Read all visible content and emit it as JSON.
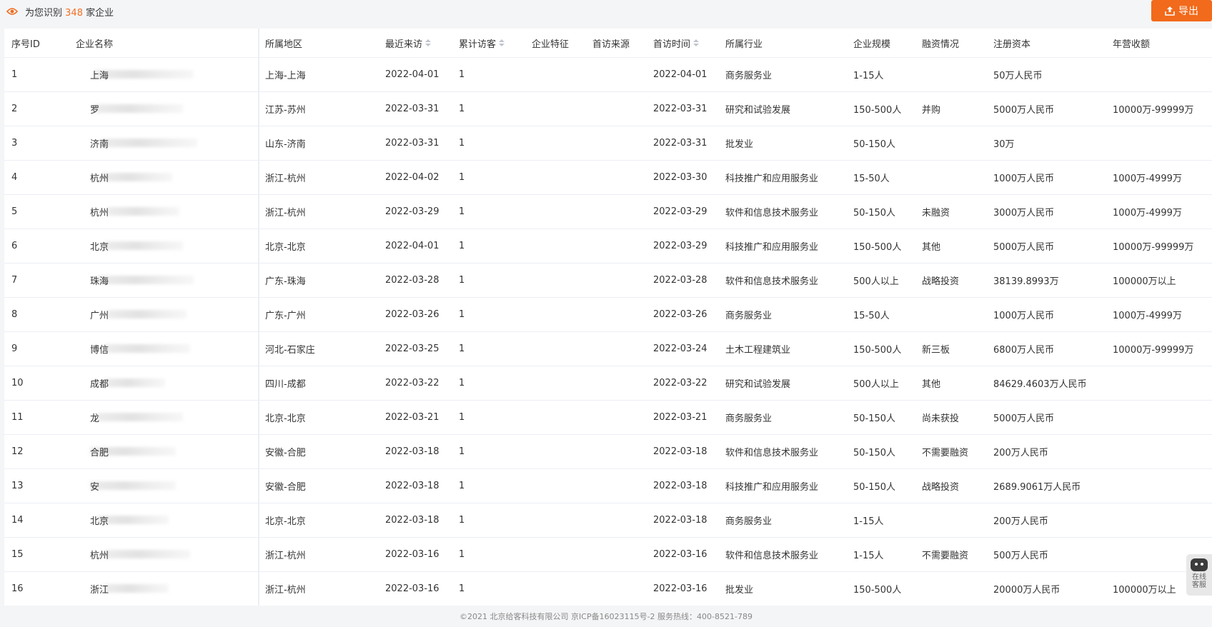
{
  "header": {
    "prefix": "为您识别",
    "count": "348",
    "suffix": "家企业",
    "export_label": "导出"
  },
  "table": {
    "columns": [
      "序号ID",
      "企业名称",
      "所属地区",
      "最近来访",
      "累计访客",
      "企业特征",
      "首访来源",
      "首访时间",
      "所属行业",
      "企业规模",
      "融资情况",
      "注册资本",
      "年营收额"
    ],
    "rows": [
      {
        "id": "1",
        "name": "上海",
        "region": "上海-上海",
        "last_visit": "2022-04-01",
        "visitors": "1",
        "feature": "",
        "source": "",
        "first_visit": "2022-04-01",
        "industry": "商务服务业",
        "size": "1-15人",
        "financing": "",
        "capital": "50万人民币",
        "revenue": ""
      },
      {
        "id": "2",
        "name": "罗",
        "region": "江苏-苏州",
        "last_visit": "2022-03-31",
        "visitors": "1",
        "feature": "",
        "source": "",
        "first_visit": "2022-03-31",
        "industry": "研究和试验发展",
        "size": "150-500人",
        "financing": "并购",
        "capital": "5000万人民币",
        "revenue": "10000万-99999万"
      },
      {
        "id": "3",
        "name": "济南",
        "region": "山东-济南",
        "last_visit": "2022-03-31",
        "visitors": "1",
        "feature": "",
        "source": "",
        "first_visit": "2022-03-31",
        "industry": "批发业",
        "size": "50-150人",
        "financing": "",
        "capital": "30万",
        "revenue": ""
      },
      {
        "id": "4",
        "name": "杭州",
        "region": "浙江-杭州",
        "last_visit": "2022-04-02",
        "visitors": "1",
        "feature": "",
        "source": "",
        "first_visit": "2022-03-30",
        "industry": "科技推广和应用服务业",
        "size": "15-50人",
        "financing": "",
        "capital": "1000万人民币",
        "revenue": "1000万-4999万"
      },
      {
        "id": "5",
        "name": "杭州",
        "region": "浙江-杭州",
        "last_visit": "2022-03-29",
        "visitors": "1",
        "feature": "",
        "source": "",
        "first_visit": "2022-03-29",
        "industry": "软件和信息技术服务业",
        "size": "50-150人",
        "financing": "未融资",
        "capital": "3000万人民币",
        "revenue": "1000万-4999万"
      },
      {
        "id": "6",
        "name": "北京",
        "region": "北京-北京",
        "last_visit": "2022-04-01",
        "visitors": "1",
        "feature": "",
        "source": "",
        "first_visit": "2022-03-29",
        "industry": "科技推广和应用服务业",
        "size": "150-500人",
        "financing": "其他",
        "capital": "5000万人民币",
        "revenue": "10000万-99999万"
      },
      {
        "id": "7",
        "name": "珠海",
        "region": "广东-珠海",
        "last_visit": "2022-03-28",
        "visitors": "1",
        "feature": "",
        "source": "",
        "first_visit": "2022-03-28",
        "industry": "软件和信息技术服务业",
        "size": "500人以上",
        "financing": "战略投资",
        "capital": "38139.8993万",
        "revenue": "100000万以上"
      },
      {
        "id": "8",
        "name": "广州",
        "region": "广东-广州",
        "last_visit": "2022-03-26",
        "visitors": "1",
        "feature": "",
        "source": "",
        "first_visit": "2022-03-26",
        "industry": "商务服务业",
        "size": "15-50人",
        "financing": "",
        "capital": "1000万人民币",
        "revenue": "1000万-4999万"
      },
      {
        "id": "9",
        "name": "博信",
        "region": "河北-石家庄",
        "last_visit": "2022-03-25",
        "visitors": "1",
        "feature": "",
        "source": "",
        "first_visit": "2022-03-24",
        "industry": "土木工程建筑业",
        "size": "150-500人",
        "financing": "新三板",
        "capital": "6800万人民币",
        "revenue": "10000万-99999万"
      },
      {
        "id": "10",
        "name": "成都",
        "region": "四川-成都",
        "last_visit": "2022-03-22",
        "visitors": "1",
        "feature": "",
        "source": "",
        "first_visit": "2022-03-22",
        "industry": "研究和试验发展",
        "size": "500人以上",
        "financing": "其他",
        "capital": "84629.4603万人民币",
        "revenue": ""
      },
      {
        "id": "11",
        "name": "龙",
        "region": "北京-北京",
        "last_visit": "2022-03-21",
        "visitors": "1",
        "feature": "",
        "source": "",
        "first_visit": "2022-03-21",
        "industry": "商务服务业",
        "size": "50-150人",
        "financing": "尚未获投",
        "capital": "5000万人民币",
        "revenue": ""
      },
      {
        "id": "12",
        "name": "合肥",
        "region": "安徽-合肥",
        "last_visit": "2022-03-18",
        "visitors": "1",
        "feature": "",
        "source": "",
        "first_visit": "2022-03-18",
        "industry": "软件和信息技术服务业",
        "size": "50-150人",
        "financing": "不需要融资",
        "capital": "200万人民币",
        "revenue": ""
      },
      {
        "id": "13",
        "name": "安",
        "region": "安徽-合肥",
        "last_visit": "2022-03-18",
        "visitors": "1",
        "feature": "",
        "source": "",
        "first_visit": "2022-03-18",
        "industry": "科技推广和应用服务业",
        "size": "50-150人",
        "financing": "战略投资",
        "capital": "2689.9061万人民币",
        "revenue": ""
      },
      {
        "id": "14",
        "name": "北京",
        "region": "北京-北京",
        "last_visit": "2022-03-18",
        "visitors": "1",
        "feature": "",
        "source": "",
        "first_visit": "2022-03-18",
        "industry": "商务服务业",
        "size": "1-15人",
        "financing": "",
        "capital": "200万人民币",
        "revenue": ""
      },
      {
        "id": "15",
        "name": "杭州",
        "region": "浙江-杭州",
        "last_visit": "2022-03-16",
        "visitors": "1",
        "feature": "",
        "source": "",
        "first_visit": "2022-03-16",
        "industry": "软件和信息技术服务业",
        "size": "1-15人",
        "financing": "不需要融资",
        "capital": "500万人民币",
        "revenue": ""
      },
      {
        "id": "16",
        "name": "浙江",
        "region": "浙江-杭州",
        "last_visit": "2022-03-16",
        "visitors": "1",
        "feature": "",
        "source": "",
        "first_visit": "2022-03-16",
        "industry": "批发业",
        "size": "150-500人",
        "financing": "",
        "capital": "20000万人民币",
        "revenue": "100000万以上"
      }
    ]
  },
  "footer": {
    "text": "©2021 北京给客科技有限公司 京ICP备16023115号-2 服务热线：400-8521-789"
  },
  "chat_widget": {
    "line1": "在线",
    "line2": "客服"
  },
  "colors": {
    "accent": "#f26a1b",
    "count": "#f27024"
  }
}
